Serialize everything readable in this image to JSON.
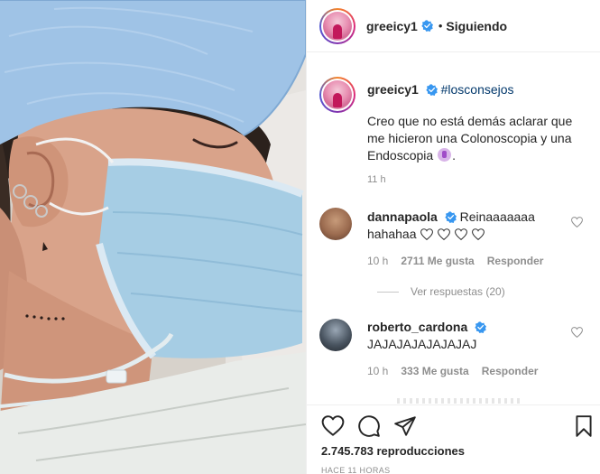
{
  "post": {
    "author": "greeicy1",
    "follow_status": "Siguiendo",
    "dot": "•",
    "caption_hashtag": "#losconsejos",
    "caption_text": "Creo que no está demás aclarar que me hicieron una Colonoscopia y una Endoscopia",
    "caption_end": ".",
    "caption_time": "11 h",
    "views": "2.745.783 reproducciones",
    "posted_ago": "HACE 11 HORAS"
  },
  "comments": [
    {
      "user": "dannapaola",
      "text_line1": "Reinaaaaaaa",
      "text_line2": "hahahaa",
      "time": "10 h",
      "likes": "2711 Me gusta",
      "reply": "Responder",
      "view_replies": "Ver respuestas (20)"
    },
    {
      "user": "roberto_cardona",
      "text": "JAJAJAJAJAJAJAJ",
      "time": "10 h",
      "likes": "333 Me gusta",
      "reply": "Responder"
    }
  ],
  "icons": {
    "like": "heart-icon",
    "comment": "comment-icon",
    "share": "share-icon",
    "save": "bookmark-icon",
    "verified": "verified-badge-icon"
  },
  "colors": {
    "hashtag": "#00376b",
    "verified": "#3897f0",
    "muted": "#8e8e8e",
    "text": "#262626"
  }
}
